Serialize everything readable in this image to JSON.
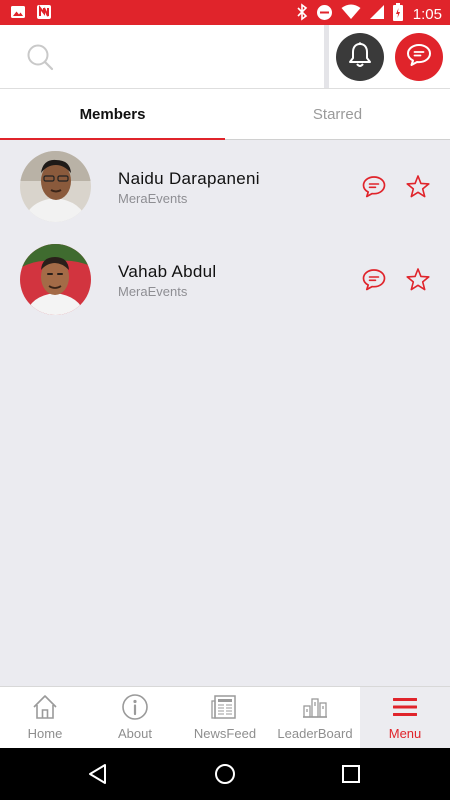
{
  "status_bar": {
    "time": "1:05",
    "left_icons": [
      "image-icon",
      "app-notification-icon"
    ],
    "right_icons": [
      "bluetooth-icon",
      "do-not-disturb-icon",
      "wifi-icon",
      "signal-icon",
      "battery-icon"
    ],
    "color": "#e0242b"
  },
  "header": {
    "search_icon": "search-icon",
    "notifications_icon": "bell-icon",
    "messages_icon": "chat-bubble-icon"
  },
  "tabs": [
    {
      "label": "Members",
      "active": true
    },
    {
      "label": "Starred",
      "active": false
    }
  ],
  "members": [
    {
      "name": "Naidu Darapaneni",
      "organization": "MeraEvents"
    },
    {
      "name": "Vahab Abdul",
      "organization": "MeraEvents"
    }
  ],
  "bottom_nav": [
    {
      "label": "Home",
      "icon": "home-icon",
      "active": false
    },
    {
      "label": "About",
      "icon": "info-icon",
      "active": false
    },
    {
      "label": "NewsFeed",
      "icon": "newspaper-icon",
      "active": false
    },
    {
      "label": "LeaderBoard",
      "icon": "leaderboard-icon",
      "active": false
    },
    {
      "label": "Menu",
      "icon": "menu-icon",
      "active": true
    }
  ],
  "colors": {
    "accent": "#e0242b",
    "background": "#ebebf0",
    "dark_button": "#3a3a3a"
  }
}
